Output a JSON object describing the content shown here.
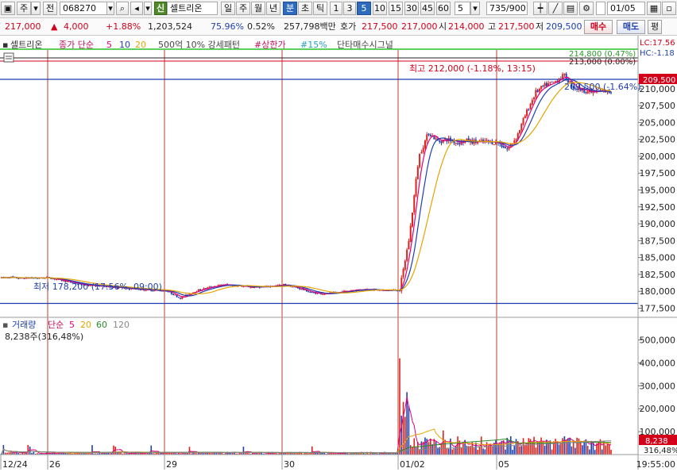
{
  "toolbar": {
    "market_type": "주",
    "prev_label": "전",
    "stock_code": "068270",
    "sector_badge": "신",
    "stock_name": "셀트리온",
    "periods": [
      "일",
      "주",
      "월",
      "년",
      "분",
      "초",
      "틱"
    ],
    "active_period": "분",
    "intervals": [
      "1",
      "3",
      "5",
      "10",
      "15",
      "30",
      "45",
      "60"
    ],
    "active_interval": "5",
    "interval_value": "5",
    "count_display": "735/900",
    "date_value": "01/05"
  },
  "quote": {
    "price": "217,000",
    "change": "4,000",
    "change_pct": "+1.88%",
    "volume": "1,203,524",
    "vol_ratio": "75.96%",
    "turnover_pct": "0.52%",
    "amount": "257,798백만",
    "ask_label": "호가",
    "ask": "217,500",
    "bid": "217,000",
    "open_label": "시",
    "open": "214,000",
    "high_label": "고",
    "high": "217,500",
    "low_label": "저",
    "low": "209,500",
    "buy_label": "매수",
    "sell_label": "매도",
    "eval_label": "평"
  },
  "legend": {
    "name": "셀트리온",
    "ma_label": "종가 단순",
    "ma_periods": [
      "5",
      "10",
      "20"
    ],
    "ma_colors": [
      "#e0007a",
      "#1f3fb0",
      "#e6a400"
    ],
    "extra1": "500억 10% 강세패턴",
    "extra2": "#상한가",
    "extra3": "#15%",
    "extra4": "단타매수시그널",
    "lc_label": "LC:17.56",
    "hc_label": "HC:-1.18"
  },
  "annotations": {
    "green_line_label": "214,800 (0.47%)",
    "ref_line_label": "213,000 (0.00%)",
    "high_label": "최고 212,000 (-1.18%, 13:15)",
    "low_label": "최저 178,200 (17.56%, 09:00)",
    "current_label": "209,500 (-1.64%)",
    "current_price_tag": "209,500",
    "vol_tag": "8,238",
    "vol_pct_tag": "316,48%"
  },
  "volume_legend": {
    "title": "거래량",
    "ma_label": "단순",
    "periods": [
      "5",
      "20",
      "60",
      "120"
    ],
    "colors": [
      "#e0007a",
      "#e6a400",
      "#2a8a2a",
      "#888888"
    ],
    "info": "8,238주(316,48%)"
  },
  "chart_data": {
    "type": "candlestick",
    "price_axis_ticks": [
      "210,000",
      "207,500",
      "205,000",
      "202,500",
      "200,000",
      "197,500",
      "195,000",
      "192,500",
      "190,000",
      "187,500",
      "185,000",
      "182,500",
      "180,000",
      "177,500"
    ],
    "price_ylim": [
      176500,
      215500
    ],
    "volume_axis_ticks": [
      "500,000",
      "400,000",
      "300,000",
      "200,000",
      "100,000"
    ],
    "volume_ylim": [
      0,
      540000
    ],
    "date_labels": [
      "12/24",
      "26",
      "29",
      "30",
      "01/02",
      "05"
    ],
    "time_label": "19:55:00",
    "day_separators_x": [
      60,
      207,
      355,
      501,
      625
    ],
    "session_days": [
      {
        "day": "12/24",
        "price_path": [
          182000,
          182100,
          181900,
          182000,
          181950,
          182000
        ]
      },
      {
        "day": "12/26",
        "price_path": [
          182000,
          181500,
          181000,
          180800,
          180600,
          180400,
          180200,
          180100
        ]
      },
      {
        "day": "12/29",
        "price_path": [
          180100,
          179000,
          180000,
          180600,
          181000,
          180800,
          180600,
          180700,
          180900
        ]
      },
      {
        "day": "12/30",
        "price_path": [
          181000,
          180500,
          179800,
          179600,
          179900,
          180200,
          180300,
          180100,
          180200
        ]
      },
      {
        "day": "01/02",
        "price_path": [
          180200,
          188000,
          200000,
          203500,
          202200,
          202500,
          202000,
          202300,
          202100,
          202200,
          202000
        ]
      },
      {
        "day": "01/05",
        "price_path": [
          202000,
          201000,
          203000,
          206500,
          209500,
          210500,
          211000,
          212000,
          210200,
          209800,
          209500,
          209700,
          209500
        ]
      }
    ],
    "reference_lines": {
      "high_price": 212000,
      "low_price": 178200,
      "green_line": 214800,
      "ref_line": 213000,
      "current": 209500
    }
  }
}
